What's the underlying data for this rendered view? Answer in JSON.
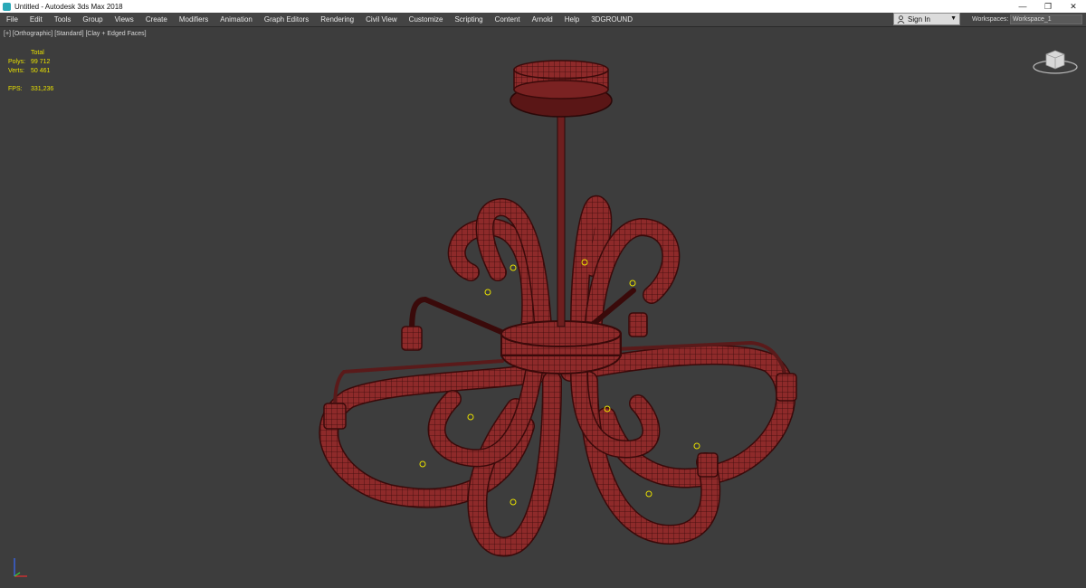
{
  "titlebar": {
    "title": "Untitled - Autodesk 3ds Max 2018",
    "minimize_icon": "minimize-icon",
    "maximize_icon": "restore-icon",
    "close_icon": "close-icon"
  },
  "menu": {
    "items": [
      "File",
      "Edit",
      "Tools",
      "Group",
      "Views",
      "Create",
      "Modifiers",
      "Animation",
      "Graph Editors",
      "Rendering",
      "Civil View",
      "Customize",
      "Scripting",
      "Content",
      "Arnold",
      "Help",
      "3DGROUND"
    ]
  },
  "signin": {
    "label": "Sign In"
  },
  "workspaces": {
    "label": "Workspaces:",
    "value": "Workspace_1"
  },
  "viewport": {
    "label": "[+] [Orthographic] [Standard] [Clay + Edged Faces]",
    "stats": {
      "header": "Total",
      "polys_label": "Polys:",
      "polys_value": "99 712",
      "verts_label": "Verts:",
      "verts_value": "50 461",
      "fps_label": "FPS:",
      "fps_value": "331,236"
    }
  },
  "colors": {
    "viewport_bg": "#3d3d3d",
    "model_red": "#8e2a2a",
    "wire": "#3a0a0a",
    "stats_yellow": "#e8e000"
  }
}
